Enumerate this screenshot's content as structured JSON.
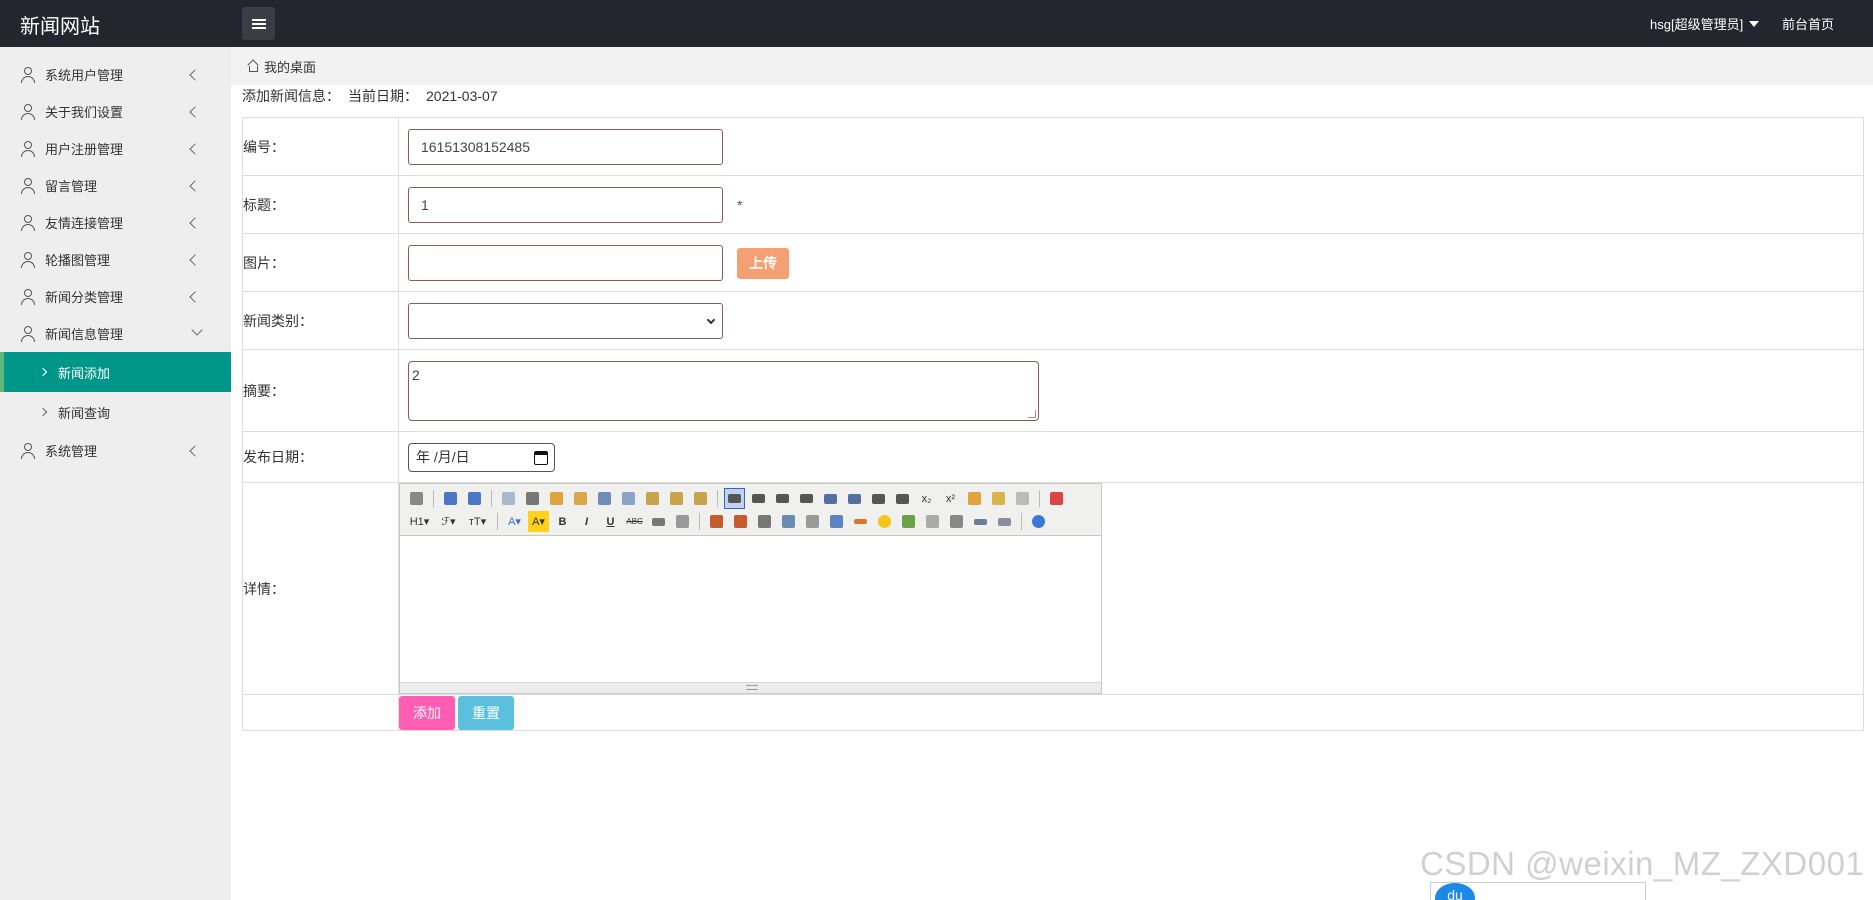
{
  "header": {
    "logo": "新闻网站",
    "user": "hsg[超级管理员]",
    "front_link": "前台首页"
  },
  "sidebar": {
    "items": [
      {
        "label": "系统用户管理",
        "state": "collapsed"
      },
      {
        "label": "关于我们设置",
        "state": "collapsed"
      },
      {
        "label": "用户注册管理",
        "state": "collapsed"
      },
      {
        "label": "留言管理",
        "state": "collapsed"
      },
      {
        "label": "友情连接管理",
        "state": "collapsed"
      },
      {
        "label": "轮播图管理",
        "state": "collapsed"
      },
      {
        "label": "新闻分类管理",
        "state": "collapsed"
      },
      {
        "label": "新闻信息管理",
        "state": "expanded"
      }
    ],
    "sub_items": [
      {
        "label": "新闻添加",
        "active": true
      },
      {
        "label": "新闻查询",
        "active": false
      }
    ],
    "last_item": {
      "label": "系统管理",
      "state": "collapsed"
    }
  },
  "breadcrumb": {
    "label": "我的桌面"
  },
  "info": {
    "title": "添加新闻信息：",
    "date_label": "当前日期：",
    "date_value": "2021-03-07"
  },
  "form": {
    "id_label": "编号：",
    "id_value": "16151308152485",
    "title_label": "标题：",
    "title_value": "1",
    "required_mark": "*",
    "image_label": "图片：",
    "image_value": "",
    "upload_label": "上传",
    "category_label": "新闻类别：",
    "category_value": "",
    "summary_label": "摘要：",
    "summary_value": "2",
    "date_label": "发布日期：",
    "date_placeholder": "年 /月/日",
    "detail_label": "详情：",
    "toolbar_text": {
      "h1": "H1▾",
      "font": "ℱ▾",
      "size": "тT▾",
      "fontcolor": "A▾",
      "bgcolor": "A▾",
      "bold": "B",
      "italic": "I",
      "underline": "U",
      "strike": "ABC",
      "sub": "x₂",
      "sup": "x²"
    },
    "add_label": "添加",
    "reset_label": "重置"
  },
  "watermark": "CSDN @weixin_MZ_ZXD001",
  "bottom_badge": "du",
  "colors": {
    "header_bg": "#23262e",
    "sidebar_bg": "#eeeeee",
    "active_bg": "#009688",
    "upload_btn": "#f4a073",
    "add_btn": "#ff5eb4",
    "reset_btn": "#5bc0de"
  }
}
